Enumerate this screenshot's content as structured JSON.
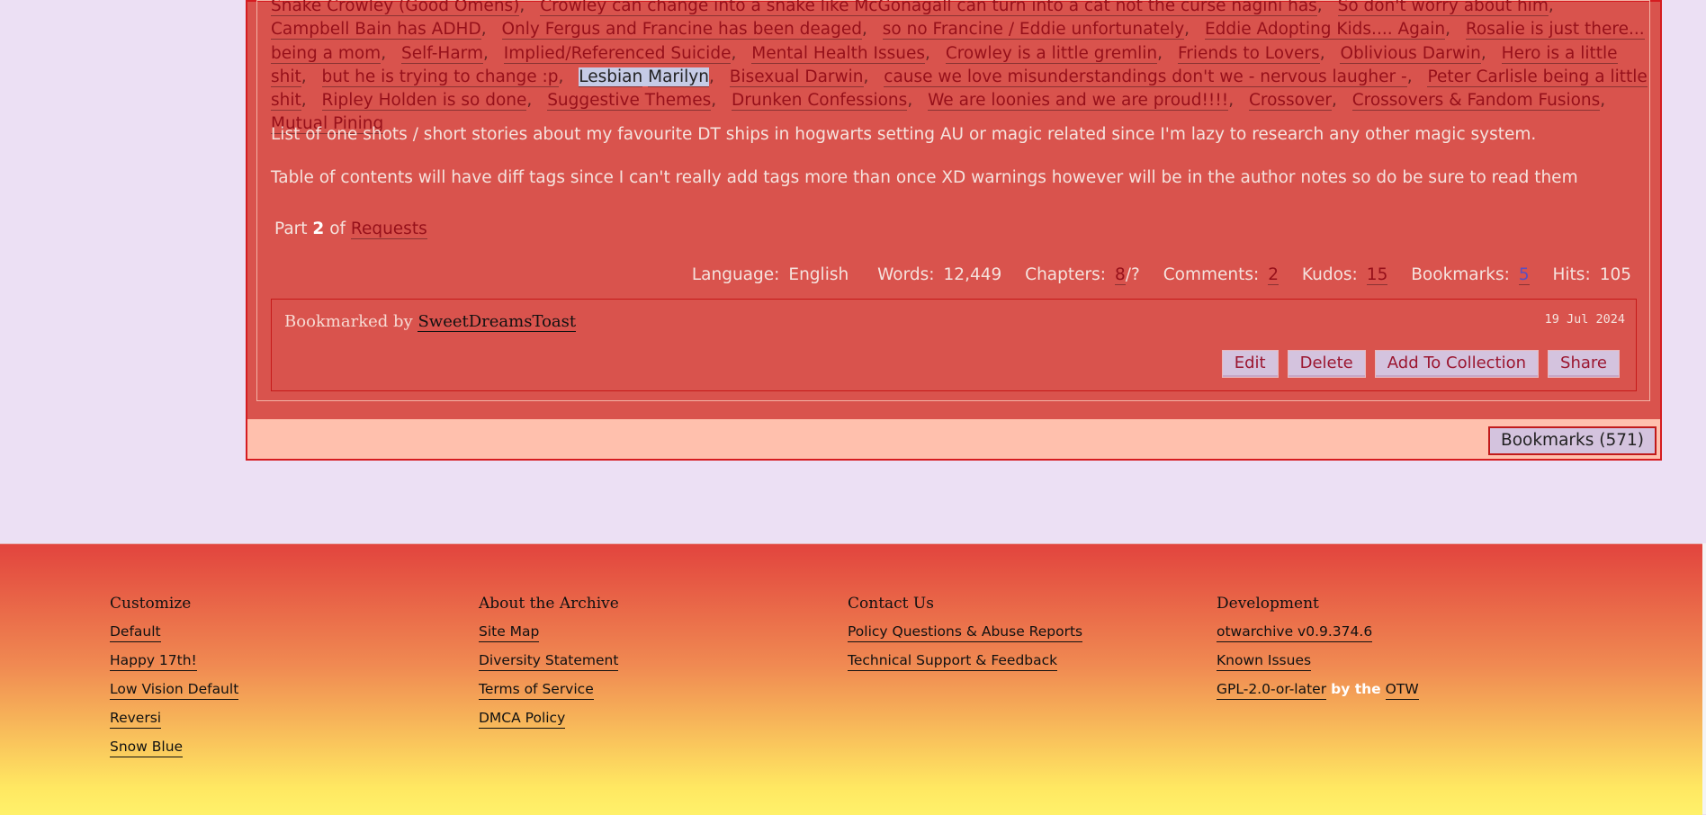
{
  "tags": [
    "Snake Crowley (Good Omens)",
    "Crowley can change into a snake like McGonagall can turn into a cat not the curse nagini has",
    "So don't worry about him",
    "Campbell Bain has ADHD",
    "Only Fergus and Francine has been deaged",
    "so no Francine / Eddie unfortunately",
    "Eddie Adopting Kids.... Again",
    "Rosalie is just there... being a mom",
    "Self-Harm",
    "Implied/Referenced Suicide",
    "Mental Health Issues",
    "Crowley is a little gremlin",
    "Friends to Lovers",
    "Oblivious Darwin",
    "Hero is a little shit",
    "but he is trying to change :p",
    "Lesbian",
    "Marilyn",
    "Bisexual Darwin",
    "cause we love misunderstandings don't we - nervous laugher -",
    "Peter Carlisle being a little shit",
    "Ripley Holden is so done",
    "Suggestive Themes",
    "Drunken Confessions",
    "We are loonies and we are proud!!!!",
    "Crossover",
    "Crossovers & Fandom Fusions",
    "Mutual Pining"
  ],
  "summary": [
    "List of one shots / short stories about my favourite DT ships in hogwarts setting AU or magic related since I'm lazy to research any other magic system.",
    "Table of contents will have diff tags since I can't really add tags more than once XD warnings however will be in the author notes so do be sure to read them"
  ],
  "series": {
    "prefix": "Part",
    "part": "2",
    "of": "of",
    "name": "Requests"
  },
  "stats": {
    "language_label": "Language:",
    "language": "English",
    "words_label": "Words:",
    "words": "12,449",
    "chapters_label": "Chapters:",
    "chapters_posted": "8",
    "chapters_total": "/?",
    "comments_label": "Comments:",
    "comments": "2",
    "kudos_label": "Kudos:",
    "kudos": "15",
    "bookmarks_label": "Bookmarks:",
    "bookmarks": "5",
    "hits_label": "Hits:",
    "hits": "105"
  },
  "bookmark": {
    "by_label": "Bookmarked by",
    "user": "SweetDreamsToast",
    "date": "19 Jul 2024",
    "actions": [
      "Edit",
      "Delete",
      "Add To Collection",
      "Share"
    ]
  },
  "bookmarks_button": "Bookmarks (571)",
  "footer": {
    "columns": [
      {
        "heading": "Customize",
        "links": [
          "Default",
          "Happy 17th!",
          "Low Vision Default",
          "Reversi",
          "Snow Blue"
        ]
      },
      {
        "heading": "About the Archive",
        "links": [
          "Site Map",
          "Diversity Statement",
          "Terms of Service",
          "DMCA Policy"
        ]
      },
      {
        "heading": "Contact Us",
        "links": [
          "Policy Questions & Abuse Reports",
          "Technical Support & Feedback"
        ]
      },
      {
        "heading": "Development",
        "links": [
          "otwarchive v0.9.374.6",
          "Known Issues"
        ]
      }
    ],
    "license_link": "GPL-2.0-or-later",
    "license_by": "by the",
    "otw_link": "OTW"
  },
  "colors": {
    "panel": "#d9534d",
    "page_bg": "#ece0f4",
    "footer_top": "#e2443e",
    "footer_bottom": "#fff16a"
  }
}
